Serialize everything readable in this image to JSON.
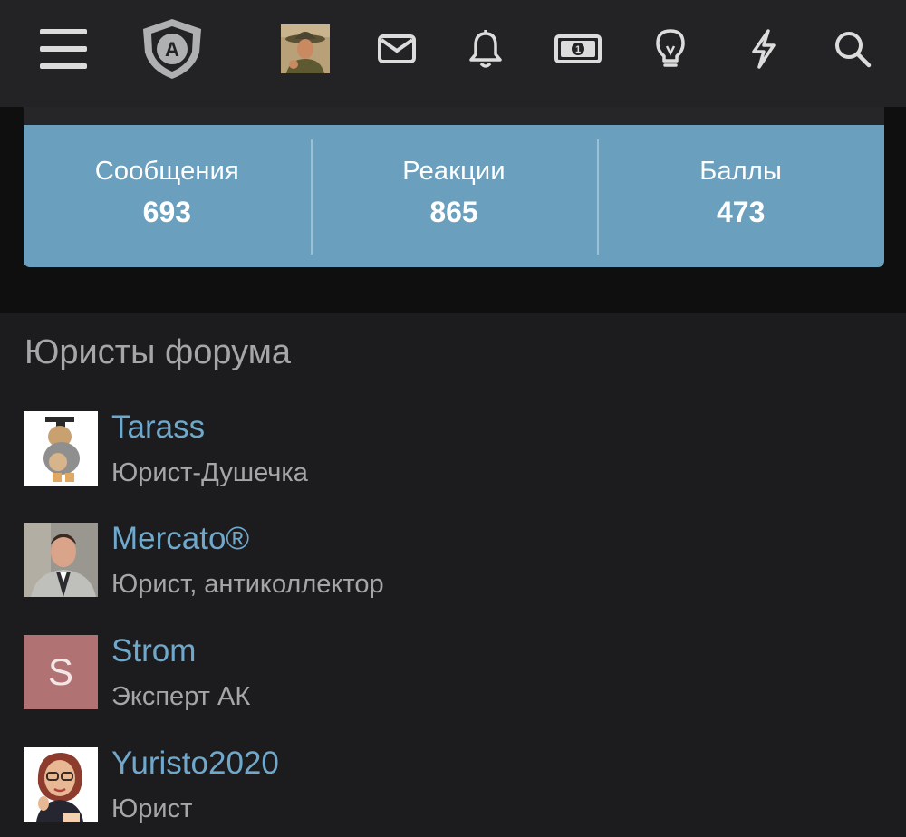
{
  "header": {
    "icons": [
      "menu-icon",
      "shield-logo-icon",
      "user-avatar",
      "mail-icon",
      "bell-icon",
      "money-icon",
      "lightbulb-icon",
      "bolt-icon",
      "search-icon"
    ],
    "logo_letter": "A",
    "colors": {
      "bar": "#232325",
      "icon": "#dcdcdc"
    }
  },
  "stats": {
    "items": [
      {
        "label": "Сообщения",
        "value": "693"
      },
      {
        "label": "Реакции",
        "value": "865"
      },
      {
        "label": "Баллы",
        "value": "473"
      }
    ],
    "color": "#6a9fbe"
  },
  "lawyers": {
    "title": "Юристы форума",
    "members": [
      {
        "name": "Tarass",
        "role": "Юрист-Душечка",
        "avatar": "cartoon-graduate-avatar"
      },
      {
        "name": "Mercato®",
        "role": "Юрист, антиколлектор",
        "avatar": "photo-avatar"
      },
      {
        "name": "Strom",
        "role": "Эксперт АК",
        "avatar_letter": "S",
        "avatar_color": "#b07272"
      },
      {
        "name": "Yuristo2020",
        "role": "Юрист",
        "avatar": "cartoon-woman-avatar"
      }
    ]
  }
}
